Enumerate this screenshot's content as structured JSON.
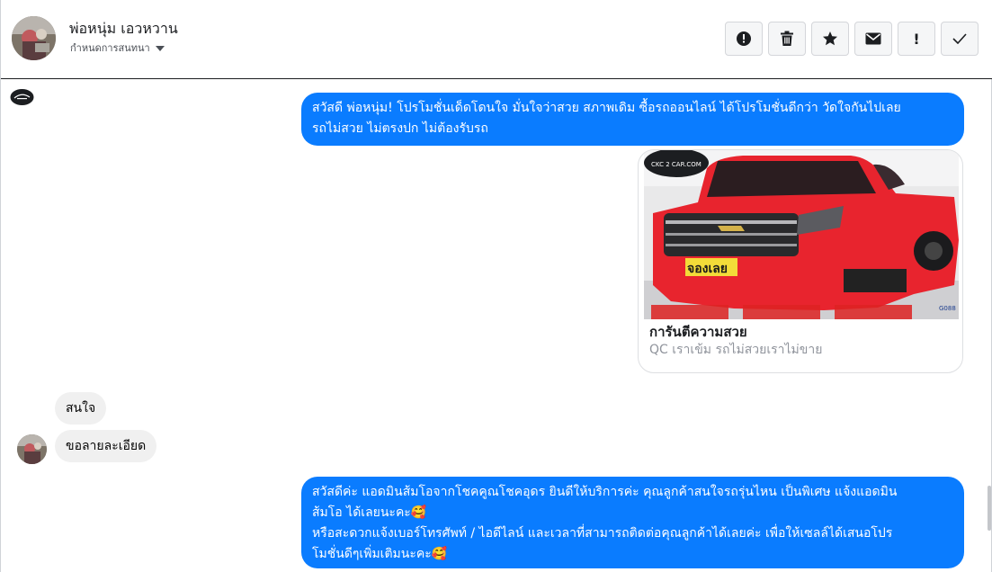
{
  "header": {
    "contact_name": "พ่อหนุ่ม เอวหวาน",
    "assign_label": "กำหนดการสนทนา",
    "actions": [
      {
        "icon": "alert-circle-icon",
        "name": "spam-button"
      },
      {
        "icon": "trash-icon",
        "name": "delete-button"
      },
      {
        "icon": "star-icon",
        "name": "star-button"
      },
      {
        "icon": "envelope-icon",
        "name": "mark-unread-button"
      },
      {
        "icon": "exclamation-icon",
        "name": "follow-up-button",
        "glyph": "!"
      },
      {
        "icon": "check-icon",
        "name": "mark-done-button"
      }
    ]
  },
  "messages": {
    "m1_line1": "สวัสดี พ่อหนุ่ม! โปรโมชั่นเด็ดโดนใจ มั่นใจว่าสวย สภาพเดิม ซื้อรถออนไลน์ ได้โปรโมชั่นดีกว่า วัดใจกันไปเลย",
    "m1_line2": "รถไม่สวย ไม่ตรงปก ไม่ต้องรับรถ",
    "card_title": "การันตีความสวย",
    "card_subtitle": "QC เราเข้ม รถไม่สวยเราไม่ขาย",
    "card_image_watermark": "CKC 2 CAR.COM",
    "card_image_badge": "จองเลย",
    "card_image_code": "G088",
    "in1": "สนใจ",
    "in2": "ขอลายละเอียด",
    "m2_line1": "สวัสดีค่ะ แอดมินส้มโอจากโชคคูณโชคอุดร ยินดีให้บริการค่ะ   คุณลูกค้าสนใจรถรุ่นไหน เป็นพิเศษ แจ้งแอดมิน",
    "m2_line2": "ส้มโอ ได้เลยนะคะ🥰",
    "m2_line3": "หรือสะดวกแจ้งเบอร์โทรศัพท์ / ไอดีไลน์ และเวลาที่สามารถติดต่อคุณลูกค้าได้เลยค่ะ เพื่อให้เซลล์ได้เสนอโปร",
    "m2_line4": "โมชั่นดีๆเพิ่มเติมนะคะ🥰"
  },
  "colors": {
    "outgoing_bubble": "#0a7cff",
    "incoming_bubble": "#f0f0f0",
    "car_body": "#e8242e"
  }
}
